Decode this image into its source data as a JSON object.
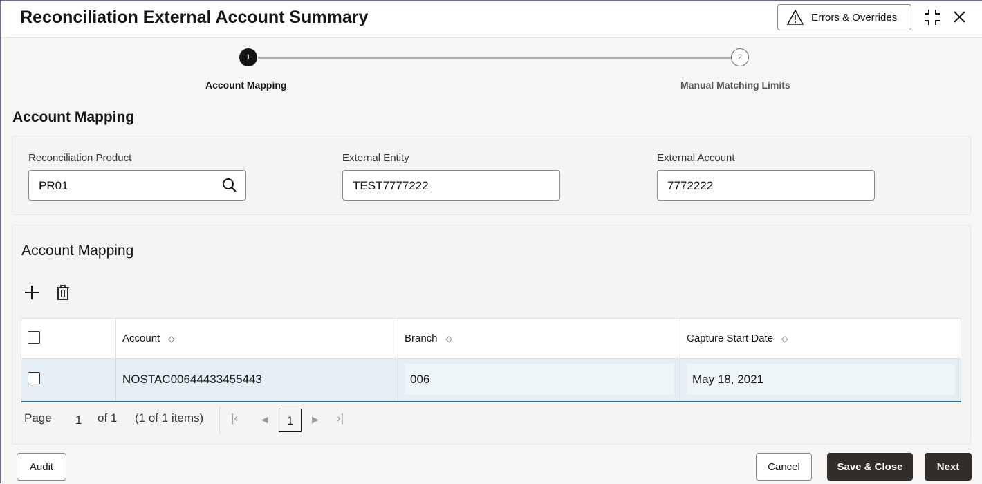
{
  "header": {
    "title": "Reconciliation External Account Summary",
    "errors_label": "Errors & Overrides"
  },
  "steps": [
    {
      "number": "1",
      "label": "Account Mapping"
    },
    {
      "number": "2",
      "label": "Manual Matching Limits"
    }
  ],
  "section_title": "Account Mapping",
  "fields": {
    "product_label": "Reconciliation Product",
    "product_value": "PR01",
    "entity_label": "External Entity",
    "entity_value": "TEST7777222",
    "account_label": "External Account",
    "account_value": "7772222"
  },
  "grid": {
    "title": "Account Mapping",
    "columns": [
      "Account",
      "Branch",
      "Capture Start Date"
    ],
    "rows": [
      {
        "account": "NOSTAC00644433455443",
        "branch": "006",
        "date": "May 18, 2021"
      }
    ]
  },
  "pager": {
    "page_label": "Page",
    "page": "1",
    "of": "of 1",
    "items": "(1 of 1 items)",
    "current": "1"
  },
  "footer": {
    "audit": "Audit",
    "cancel": "Cancel",
    "save_close": "Save & Close",
    "next": "Next"
  }
}
